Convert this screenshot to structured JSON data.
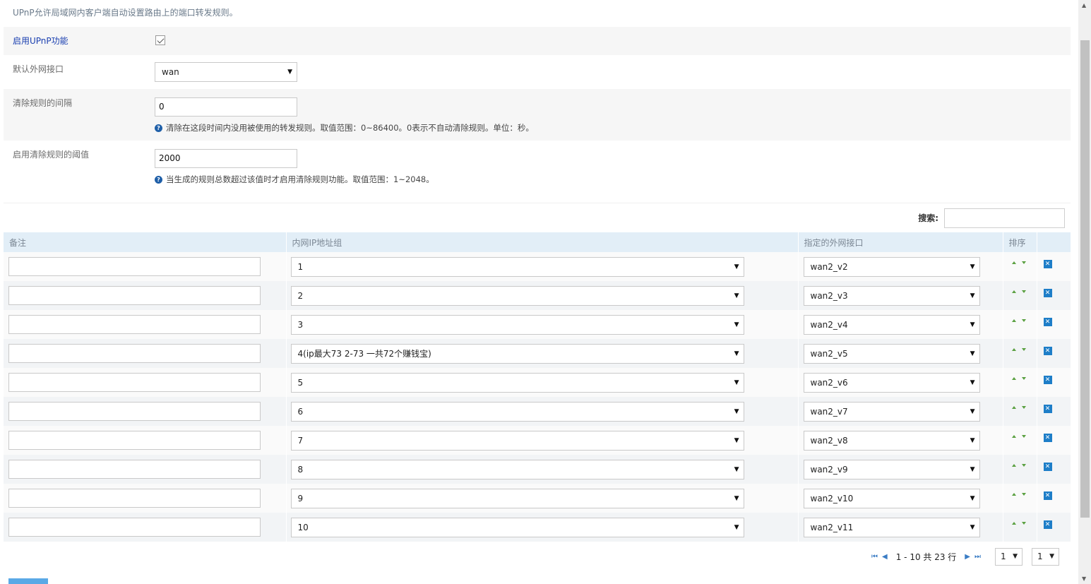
{
  "description": "UPnP允许局域网内客户端自动设置路由上的端口转发规则。",
  "form": {
    "enable_label": "启用UPnP功能",
    "enable_checked": true,
    "wan_label": "默认外网接口",
    "wan_value": "wan",
    "clear_interval_label": "清除规则的间隔",
    "clear_interval_value": "0",
    "clear_interval_hint": "清除在这段时间内没用被使用的转发规则。取值范围：0~86400。0表示不自动清除规则。单位：秒。",
    "threshold_label": "启用清除规则的阈值",
    "threshold_value": "2000",
    "threshold_hint": "当生成的规则总数超过该值时才启用清除规则功能。取值范围：1~2048。"
  },
  "search": {
    "label": "搜索:",
    "value": ""
  },
  "table": {
    "headers": {
      "remark": "备注",
      "ip_group": "内网IP地址组",
      "wan_iface": "指定的外网接口",
      "order": "排序",
      "delete": ""
    },
    "rows": [
      {
        "remark": "",
        "ip_group": "1",
        "wan_iface": "wan2_v2"
      },
      {
        "remark": "",
        "ip_group": "2",
        "wan_iface": "wan2_v3"
      },
      {
        "remark": "",
        "ip_group": "3",
        "wan_iface": "wan2_v4"
      },
      {
        "remark": "",
        "ip_group": "4(ip最大73 2-73 一共72个赚钱宝)",
        "wan_iface": "wan2_v5"
      },
      {
        "remark": "",
        "ip_group": "5",
        "wan_iface": "wan2_v6"
      },
      {
        "remark": "",
        "ip_group": "6",
        "wan_iface": "wan2_v7"
      },
      {
        "remark": "",
        "ip_group": "7",
        "wan_iface": "wan2_v8"
      },
      {
        "remark": "",
        "ip_group": "8",
        "wan_iface": "wan2_v9"
      },
      {
        "remark": "",
        "ip_group": "9",
        "wan_iface": "wan2_v10"
      },
      {
        "remark": "",
        "ip_group": "10",
        "wan_iface": "wan2_v11"
      }
    ]
  },
  "pager": {
    "range_text": "1 - 10 共 23 行",
    "page_value": "1",
    "size_value": "1"
  },
  "icons": {
    "help": "question-circle-icon",
    "move_up": "arrow-up-icon",
    "move_down": "arrow-down-icon",
    "delete": "close-square-icon",
    "first": "first-page-icon",
    "prev": "prev-page-icon",
    "next": "next-page-icon",
    "last": "last-page-icon"
  },
  "colors": {
    "accent": "#1e7ec8",
    "header_bg": "#e2eef7",
    "arrow_green": "#5aa040"
  }
}
